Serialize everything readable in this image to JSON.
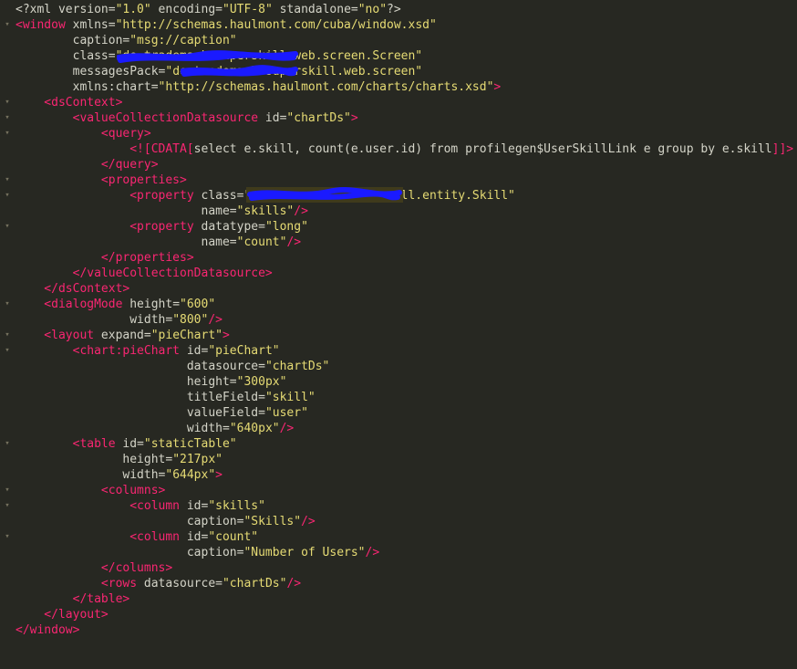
{
  "colors": {
    "background": "#272822",
    "tag": "#f92672",
    "attr": "#d4d4c8",
    "string": "#e6db74",
    "redaction": "#1a1aff"
  },
  "lines": [
    [
      {
        "t": "<?xml version=",
        "c": "txt"
      },
      {
        "t": "\"1.0\"",
        "c": "str"
      },
      {
        "t": " encoding=",
        "c": "txt"
      },
      {
        "t": "\"UTF-8\"",
        "c": "str"
      },
      {
        "t": " standalone=",
        "c": "txt"
      },
      {
        "t": "\"no\"",
        "c": "str"
      },
      {
        "t": "?>",
        "c": "txt"
      }
    ],
    [
      {
        "t": "<window",
        "c": "tag"
      },
      {
        "t": " xmlns=",
        "c": "attr"
      },
      {
        "t": "\"http://schemas.haulmont.com/cuba/window.xsd\"",
        "c": "str"
      }
    ],
    [
      {
        "t": "        caption=",
        "c": "attr"
      },
      {
        "t": "\"msg://caption\"",
        "c": "str"
      }
    ],
    [
      {
        "t": "        class=",
        "c": "attr"
      },
      {
        "t": "\"de.trademark.superskill.web.screen.Screen\"",
        "c": "str"
      }
    ],
    [
      {
        "t": "        messagesPack=",
        "c": "attr"
      },
      {
        "t": "\"de.trademark.superskill.web.screen\"",
        "c": "str"
      }
    ],
    [
      {
        "t": "        xmlns:chart=",
        "c": "attr"
      },
      {
        "t": "\"http://schemas.haulmont.com/charts/charts.xsd\"",
        "c": "str"
      },
      {
        "t": ">",
        "c": "tag"
      }
    ],
    [
      {
        "t": "    <dsContext>",
        "c": "tag"
      }
    ],
    [
      {
        "t": "        <valueCollectionDatasource",
        "c": "tag"
      },
      {
        "t": " id=",
        "c": "attr"
      },
      {
        "t": "\"chartDs\"",
        "c": "str"
      },
      {
        "t": ">",
        "c": "tag"
      }
    ],
    [
      {
        "t": "            <query>",
        "c": "tag"
      }
    ],
    [
      {
        "t": "                <![CDATA[",
        "c": "tag"
      },
      {
        "t": "select e.skill, count(e.user.id) from profilegen$UserSkillLink e group by e.skill",
        "c": "txt"
      },
      {
        "t": "]]>",
        "c": "tag"
      }
    ],
    [
      {
        "t": "            </query>",
        "c": "tag"
      }
    ],
    [
      {
        "t": "            <properties>",
        "c": "tag"
      }
    ],
    [
      {
        "t": "                <property",
        "c": "tag"
      },
      {
        "t": " class=",
        "c": "attr"
      },
      {
        "t": "\"de.trademark.superskill.entity.Skill\"",
        "c": "str"
      }
    ],
    [
      {
        "t": "                          name=",
        "c": "attr"
      },
      {
        "t": "\"skills\"",
        "c": "str"
      },
      {
        "t": "/>",
        "c": "tag"
      }
    ],
    [
      {
        "t": "                <property",
        "c": "tag"
      },
      {
        "t": " datatype=",
        "c": "attr"
      },
      {
        "t": "\"long\"",
        "c": "str"
      }
    ],
    [
      {
        "t": "                          name=",
        "c": "attr"
      },
      {
        "t": "\"count\"",
        "c": "str"
      },
      {
        "t": "/>",
        "c": "tag"
      }
    ],
    [
      {
        "t": "            </properties>",
        "c": "tag"
      }
    ],
    [
      {
        "t": "        </valueCollectionDatasource>",
        "c": "tag"
      }
    ],
    [
      {
        "t": "    </dsContext>",
        "c": "tag"
      }
    ],
    [
      {
        "t": "    <dialogMode",
        "c": "tag"
      },
      {
        "t": " height=",
        "c": "attr"
      },
      {
        "t": "\"600\"",
        "c": "str"
      }
    ],
    [
      {
        "t": "                width=",
        "c": "attr"
      },
      {
        "t": "\"800\"",
        "c": "str"
      },
      {
        "t": "/>",
        "c": "tag"
      }
    ],
    [
      {
        "t": "    <layout",
        "c": "tag"
      },
      {
        "t": " expand=",
        "c": "attr"
      },
      {
        "t": "\"pieChart\"",
        "c": "str"
      },
      {
        "t": ">",
        "c": "tag"
      }
    ],
    [
      {
        "t": "        <chart:pieChart",
        "c": "tag"
      },
      {
        "t": " id=",
        "c": "attr"
      },
      {
        "t": "\"pieChart\"",
        "c": "str"
      }
    ],
    [
      {
        "t": "                        datasource=",
        "c": "attr"
      },
      {
        "t": "\"chartDs\"",
        "c": "str"
      }
    ],
    [
      {
        "t": "                        height=",
        "c": "attr"
      },
      {
        "t": "\"300px\"",
        "c": "str"
      }
    ],
    [
      {
        "t": "                        titleField=",
        "c": "attr"
      },
      {
        "t": "\"skill\"",
        "c": "str"
      }
    ],
    [
      {
        "t": "                        valueField=",
        "c": "attr"
      },
      {
        "t": "\"user\"",
        "c": "str"
      }
    ],
    [
      {
        "t": "                        width=",
        "c": "attr"
      },
      {
        "t": "\"640px\"",
        "c": "str"
      },
      {
        "t": "/>",
        "c": "tag"
      }
    ],
    [
      {
        "t": "        <table",
        "c": "tag"
      },
      {
        "t": " id=",
        "c": "attr"
      },
      {
        "t": "\"staticTable\"",
        "c": "str"
      }
    ],
    [
      {
        "t": "               height=",
        "c": "attr"
      },
      {
        "t": "\"217px\"",
        "c": "str"
      }
    ],
    [
      {
        "t": "               width=",
        "c": "attr"
      },
      {
        "t": "\"644px\"",
        "c": "str"
      },
      {
        "t": ">",
        "c": "tag"
      }
    ],
    [
      {
        "t": "            <columns>",
        "c": "tag"
      }
    ],
    [
      {
        "t": "                <column",
        "c": "tag"
      },
      {
        "t": " id=",
        "c": "attr"
      },
      {
        "t": "\"skills\"",
        "c": "str"
      }
    ],
    [
      {
        "t": "                        caption=",
        "c": "attr"
      },
      {
        "t": "\"Skills\"",
        "c": "str"
      },
      {
        "t": "/>",
        "c": "tag"
      }
    ],
    [
      {
        "t": "                <column",
        "c": "tag"
      },
      {
        "t": " id=",
        "c": "attr"
      },
      {
        "t": "\"count\"",
        "c": "str"
      }
    ],
    [
      {
        "t": "                        caption=",
        "c": "attr"
      },
      {
        "t": "\"Number of Users\"",
        "c": "str"
      },
      {
        "t": "/>",
        "c": "tag"
      }
    ],
    [
      {
        "t": "            </columns>",
        "c": "tag"
      }
    ],
    [
      {
        "t": "            <rows",
        "c": "tag"
      },
      {
        "t": " datasource=",
        "c": "attr"
      },
      {
        "t": "\"chartDs\"",
        "c": "str"
      },
      {
        "t": "/>",
        "c": "tag"
      }
    ],
    [
      {
        "t": "        </table>",
        "c": "tag"
      }
    ],
    [
      {
        "t": "    </layout>",
        "c": "tag"
      }
    ],
    [
      {
        "t": "</window>",
        "c": "tag"
      }
    ]
  ],
  "fold_markers": {
    "1": "minus",
    "6": "minus",
    "7": "minus",
    "8": "minus",
    "11": "minus",
    "12": "minus",
    "14": "minus",
    "19": "minus",
    "21": "minus",
    "22": "minus",
    "28": "minus",
    "31": "minus",
    "32": "minus",
    "34": "minus"
  }
}
